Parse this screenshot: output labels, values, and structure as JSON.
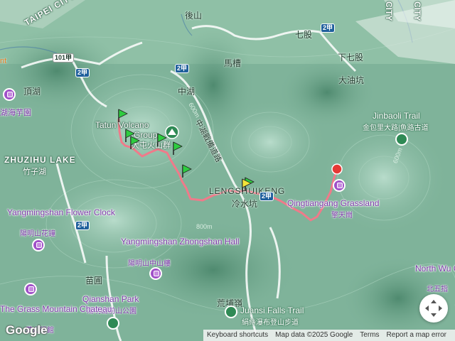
{
  "map": {
    "labels": {
      "taipei_city": "TAIPEI CITY",
      "city_right_a": "CITY",
      "city_right_b": "CITY",
      "houshan": "後山",
      "qigu": "七股",
      "xiaqigu": "下七股",
      "dayoukeng": "大油坑",
      "masao": "馬槽",
      "zhonghu": "中湖",
      "dinghu": "頂湖",
      "zhuzihu_lake_en": "ZHUZIHU LAKE",
      "zhuzihu_lake_zh": "竹子湖",
      "lengshuikeng_en": "LENGSHUIKENG",
      "lengshuikeng_zh": "冷水坑",
      "huangxiling": "荒埔嶺",
      "miaopu": "苗圃",
      "yangjin_highway": "中湖戰備道路",
      "tatun_volcano_en": "Tatun Volcano",
      "tatun_volcano_en2": "Group",
      "tatun_volcano_zh": "大屯火山群",
      "hairy_field_zh": "湖海芋園",
      "orange_edge": "nt"
    },
    "pois": {
      "yangmingshan_flower_clock_en": "Yangmingshan Flower Clock",
      "yangmingshan_flower_clock_zh": "陽明山花鐘",
      "zhongshan_hall_en": "Yangmingshan Zhongshan Hall",
      "zhongshan_hall_zh": "陽明山中山樓",
      "qianshan_park_en": "Qianshan Park",
      "qianshan_park_zh": "陽明山前山公園",
      "grass_mountain_chateau_en": "The Grass Mountain Chateau",
      "grass_mountain_chateau_zh": "草山行館",
      "qingtiangang_en": "Qingtiangang Grassland",
      "qingtiangang_zh": "擎天崗",
      "north_wu_en": "North Wu Grass",
      "north_wu_zh": "北五指",
      "jinbaoli_en": "Jinbaoli Trail",
      "jinbaoli_zh": "金包里大路|魚路古道",
      "juansi_en": "Juansi Falls Trail",
      "juansi_zh": "絹絲瀑布登山步道"
    },
    "roads": {
      "r101": "101甲",
      "r2jia_a": "2甲",
      "r2jia_b": "2甲",
      "r2jia_c": "2甲",
      "r2p": "2甲",
      "r2jia_d": "2甲"
    },
    "contours": {
      "c600a": "600m",
      "c600b": "600m",
      "c800": "800m"
    },
    "route": {
      "color": "#f07a8a",
      "start_marker_color": "#e53935",
      "waypoint_color": "#2ecc40",
      "highlight_waypoint_color": "#f2e33a"
    },
    "attribution": {
      "shortcuts": "Keyboard shortcuts",
      "data": "Map data ©2025 Google",
      "terms": "Terms",
      "report": "Report a map error"
    },
    "logo": "Google",
    "controls": {
      "fullscreen_icon": "fullscreen-icon"
    }
  }
}
